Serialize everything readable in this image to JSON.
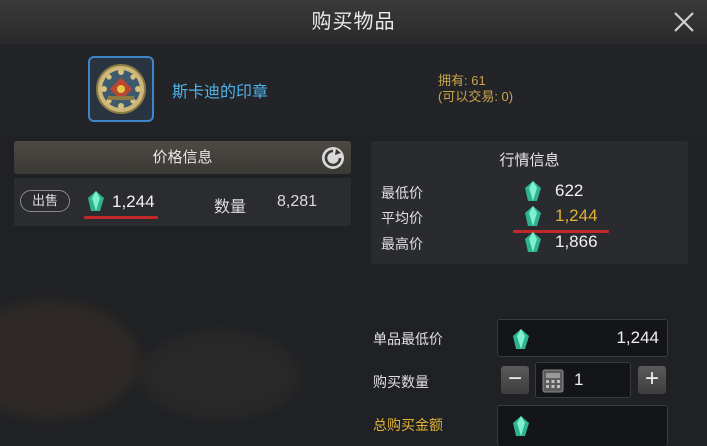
{
  "dialog": {
    "title": "购买物品"
  },
  "item": {
    "name": "斯卡迪的印章",
    "owned": "拥有: 61",
    "tradable": "(可以交易: 0)"
  },
  "price_info": {
    "header": "价格信息",
    "sell_badge": "出售",
    "price": "1,244",
    "quantity_label": "数量",
    "quantity": "8,281"
  },
  "market_info": {
    "header": "行情信息",
    "rows": [
      {
        "label": "最低价",
        "value": "622"
      },
      {
        "label": "平均价",
        "value": "1,244"
      },
      {
        "label": "最高价",
        "value": "1,866"
      }
    ]
  },
  "purchase": {
    "unit_min_label": "单品最低价",
    "unit_min_value": "1,244",
    "quantity_label": "购买数量",
    "quantity_value": "1",
    "minus": "−",
    "plus": "+",
    "total_label": "总购买金额",
    "total_value": ""
  },
  "icons": [
    "close-icon",
    "refresh-icon",
    "gem-icon",
    "calculator-icon",
    "seal-emblem-icon"
  ],
  "colors": {
    "accent_gold": "#e2b235",
    "item_name_blue": "#4db3e8",
    "highlight_red": "#c0282a",
    "gem_teal": "#3fd0a8"
  }
}
